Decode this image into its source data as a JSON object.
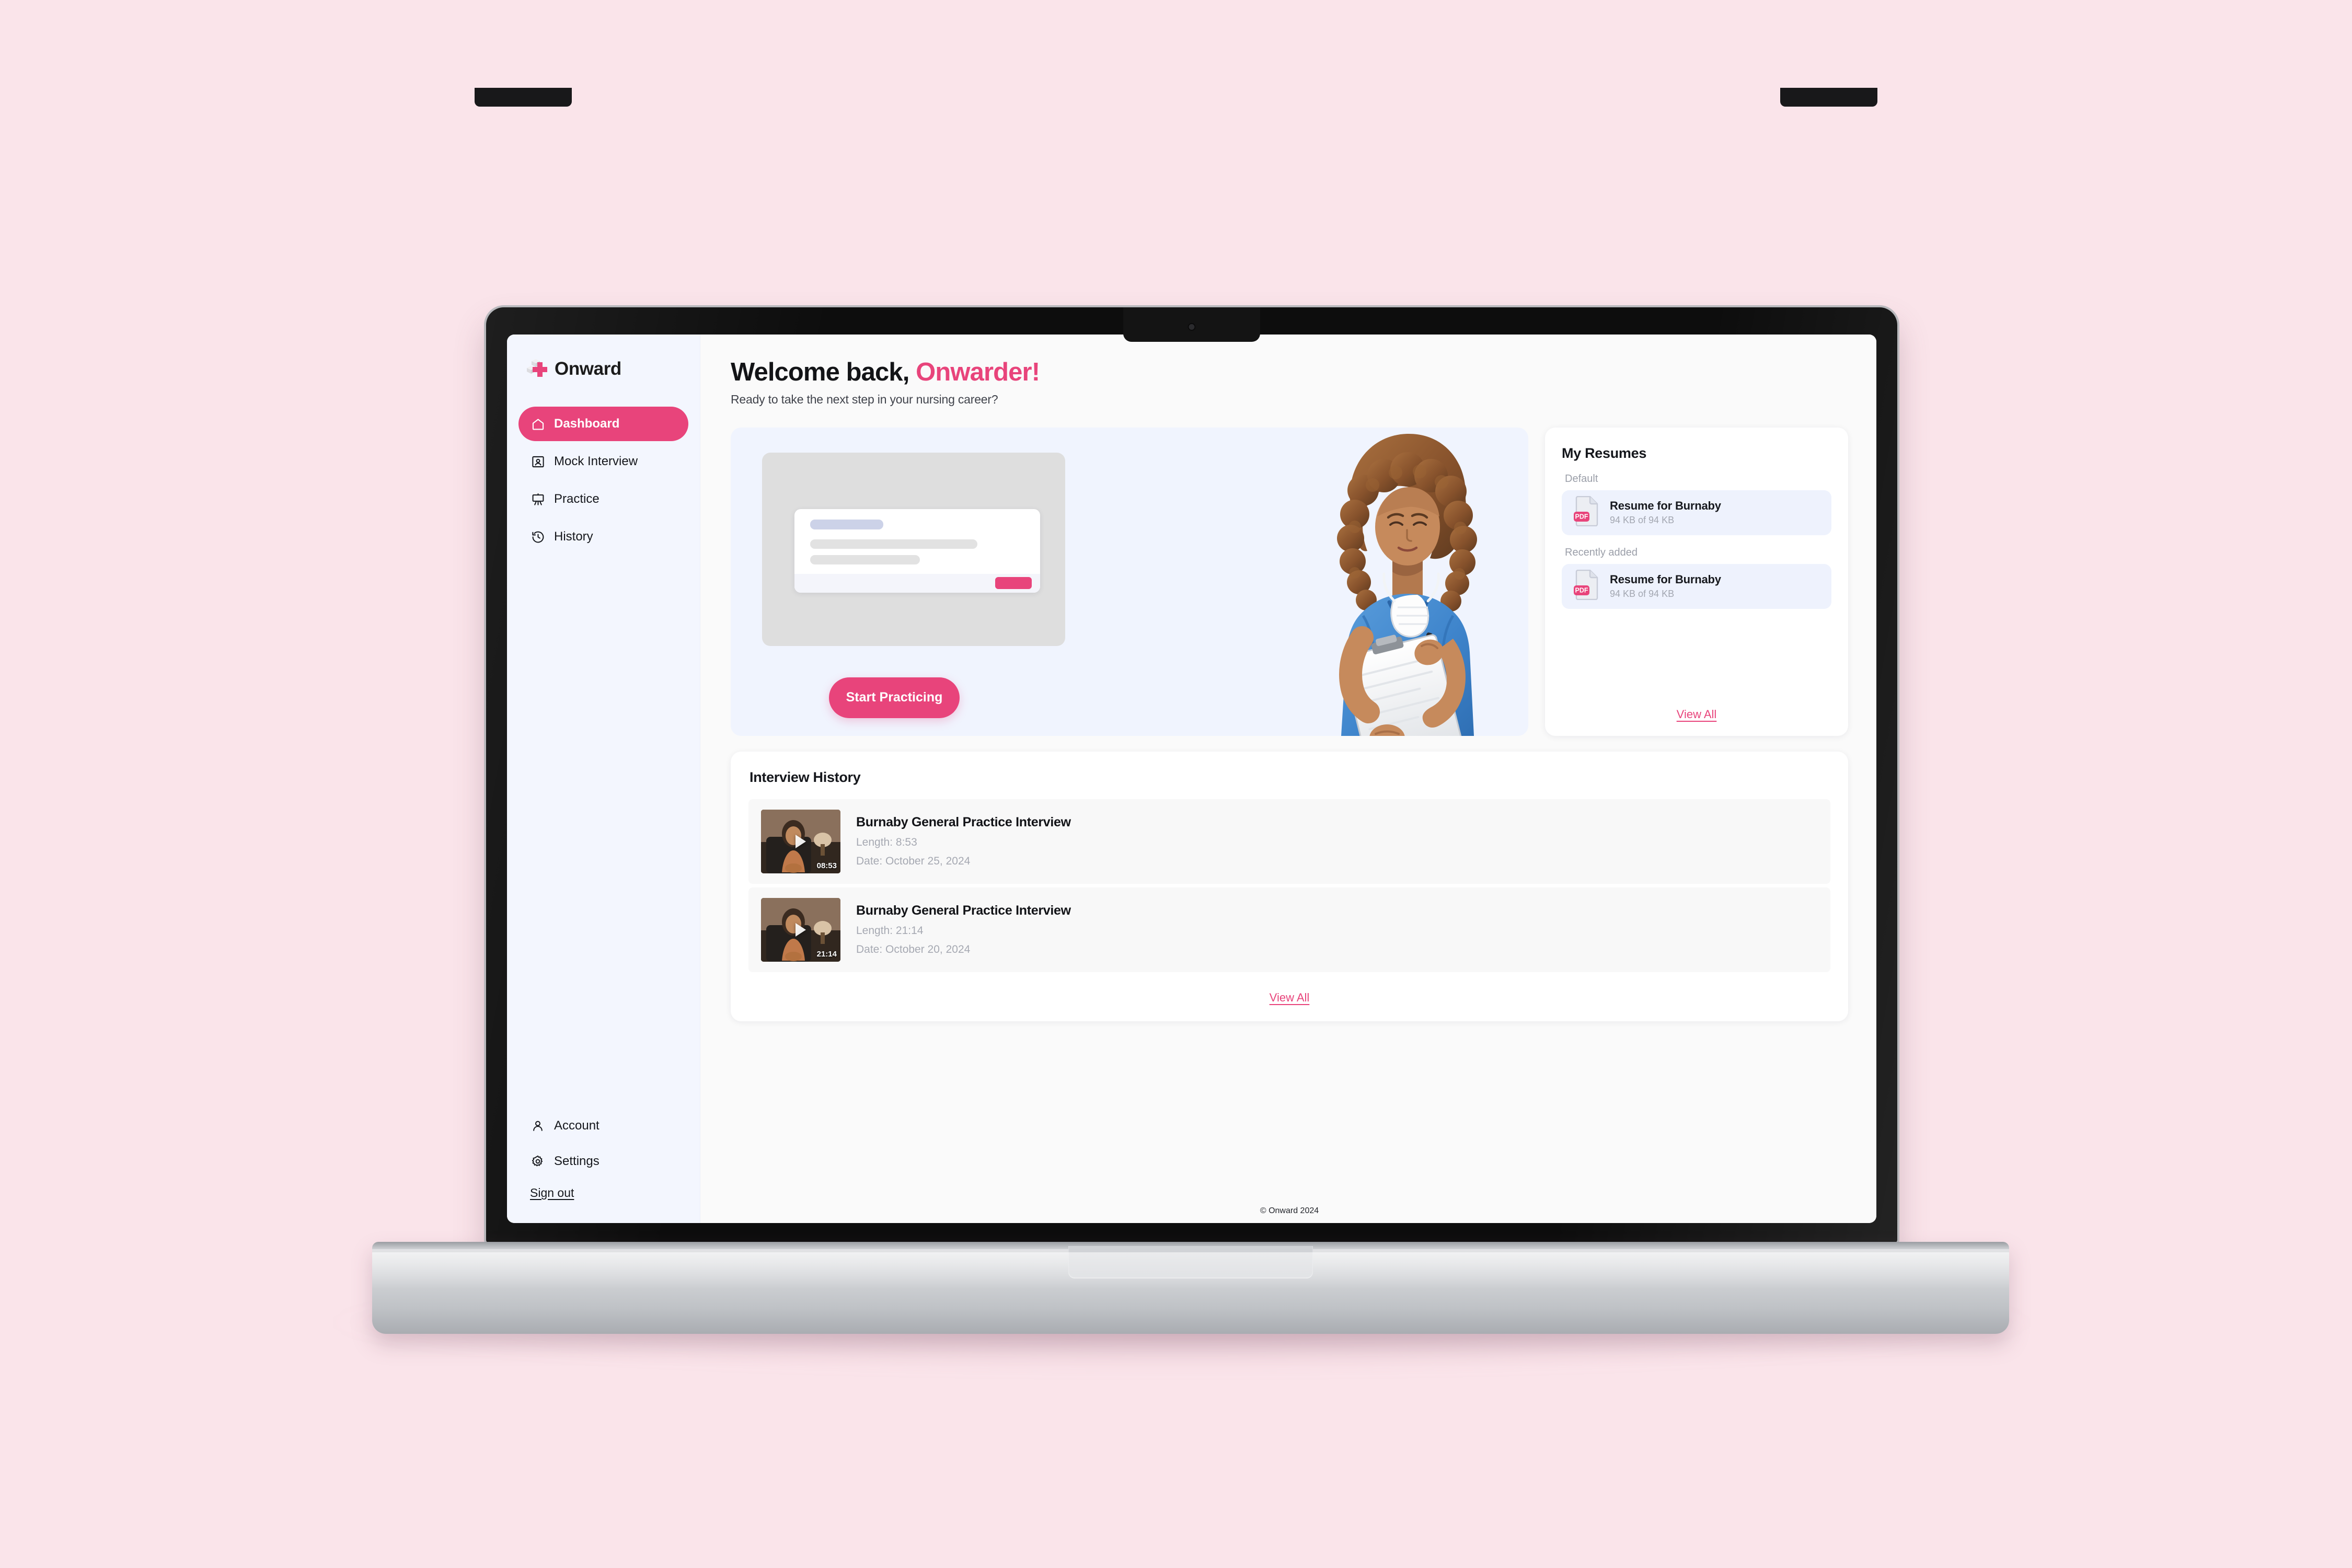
{
  "brand": {
    "name": "Onward",
    "logo_icon": "medical-cross-logo"
  },
  "sidebar": {
    "items": [
      {
        "label": "Dashboard",
        "icon": "home-icon",
        "active": true
      },
      {
        "label": "Mock Interview",
        "icon": "presentation-person-icon",
        "active": false
      },
      {
        "label": "Practice",
        "icon": "easel-board-icon",
        "active": false
      },
      {
        "label": "History",
        "icon": "clock-rewind-icon",
        "active": false
      }
    ],
    "bottom_items": [
      {
        "label": "Account",
        "icon": "user-icon"
      },
      {
        "label": "Settings",
        "icon": "gear-icon"
      }
    ],
    "signout_label": "Sign out"
  },
  "header": {
    "greeting_prefix": "Welcome back,",
    "greeting_name": "Onwarder!",
    "subtitle": "Ready to take the next step in your nursing career?"
  },
  "hero": {
    "cta_label": "Start Practicing",
    "illustration": "nurse-with-clipboard"
  },
  "resumes": {
    "title": "My Resumes",
    "groups": [
      {
        "label": "Default",
        "items": [
          {
            "name": "Resume for Burnaby",
            "size": "94 KB of 94 KB",
            "file_type": "PDF",
            "icon": "pdf-file-icon"
          }
        ]
      },
      {
        "label": "Recently added",
        "items": [
          {
            "name": "Resume for Burnaby",
            "size": "94 KB of 94 KB",
            "file_type": "PDF",
            "icon": "pdf-file-icon"
          }
        ]
      }
    ],
    "view_all_label": "View All"
  },
  "history": {
    "title": "Interview History",
    "items": [
      {
        "title": "Burnaby General Practice Interview",
        "length_label": "Length: 8:53",
        "date_label": "Date: October 25, 2024",
        "duration_badge": "08:53"
      },
      {
        "title": "Burnaby General Practice Interview",
        "length_label": "Length: 21:14",
        "date_label": "Date: October 20, 2024",
        "duration_badge": "21:14"
      }
    ],
    "view_all_label": "View All"
  },
  "footer": {
    "copyright": "© Onward 2024"
  },
  "colors": {
    "accent_pink": "#e8447b",
    "page_background": "#fae4ea",
    "sidebar_background": "#f3f6fe",
    "hero_background": "#f0f4fe",
    "resume_row_background": "#eef2fd"
  }
}
